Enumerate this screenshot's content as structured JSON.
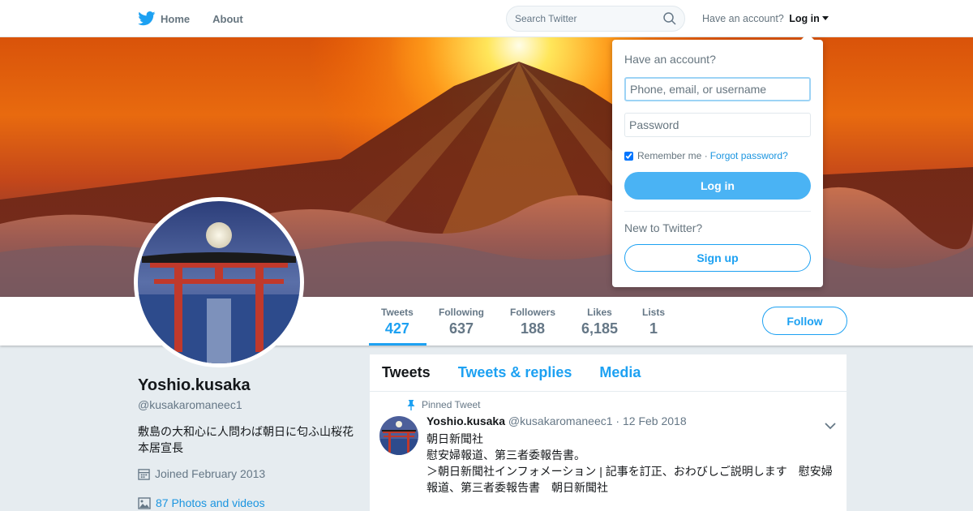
{
  "nav": {
    "home_label": "Home",
    "about_label": "About",
    "search_placeholder": "Search Twitter",
    "have_account": "Have an account?",
    "login_label": "Log in"
  },
  "login_dropdown": {
    "title": "Have an account?",
    "username_placeholder": "Phone, email, or username",
    "password_placeholder": "Password",
    "remember_me": "Remember me",
    "separator": "·",
    "forgot_password": "Forgot password?",
    "remember_checked": true,
    "login_button": "Log in",
    "new_to_twitter": "New to Twitter?",
    "signup_button": "Sign up"
  },
  "stats": {
    "tweets": {
      "label": "Tweets",
      "value": "427"
    },
    "following": {
      "label": "Following",
      "value": "637"
    },
    "followers": {
      "label": "Followers",
      "value": "188"
    },
    "likes": {
      "label": "Likes",
      "value": "6,185"
    },
    "lists": {
      "label": "Lists",
      "value": "1"
    },
    "follow_button": "Follow"
  },
  "profile": {
    "name": "Yoshio.kusaka",
    "handle": "@kusakaromaneec1",
    "bio": "敷島の大和心に人問わば朝日に匂ふ山桜花 本居宣長",
    "joined": "Joined February 2013",
    "photos": "87 Photos and videos"
  },
  "timeline": {
    "tabs": [
      "Tweets",
      "Tweets & replies",
      "Media"
    ],
    "pinned_label": "Pinned Tweet",
    "tweet": {
      "name": "Yoshio.kusaka",
      "handle": "@kusakaromaneec1",
      "separator": "·",
      "date": "12 Feb 2018",
      "lines": [
        "朝日新聞社",
        "慰安婦報道、第三者委報告書。",
        "＞朝日新聞社インフォメーション | 記事を訂正、おわびしご説明します　慰安婦報道、第三者委報告書　朝日新聞社"
      ]
    }
  },
  "colors": {
    "brand_blue": "#1da1f2",
    "text_gray": "#657786"
  },
  "icons": [
    "twitter-bird-icon",
    "home-icon",
    "search-icon",
    "caret-down-icon",
    "pin-icon",
    "calendar-icon",
    "photo-icon",
    "chevron-down-icon"
  ]
}
